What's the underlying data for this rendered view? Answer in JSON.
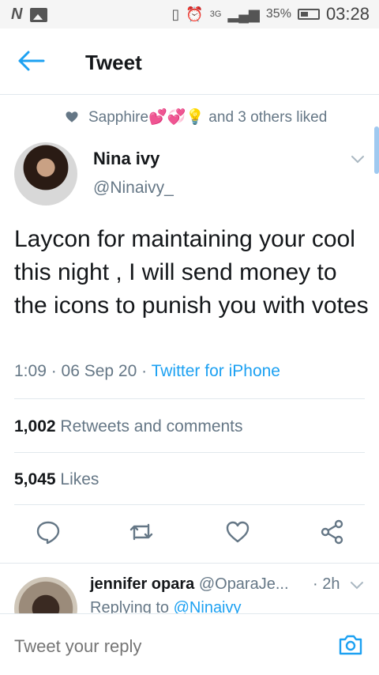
{
  "status_bar": {
    "left_icons": [
      "n-icon",
      "gallery-icon"
    ],
    "n_glyph": "N",
    "network": "3G",
    "battery": "35%",
    "time": "03:28"
  },
  "header": {
    "title": "Tweet"
  },
  "liked": {
    "text": "Sapphire💕💞💡 and 3 others liked"
  },
  "tweet": {
    "author_name": "Nina ivy",
    "author_handle": "@Ninaivy_",
    "text": "Laycon for maintaining your cool this night , I will send money to the icons to punish you with votes",
    "time": "1:09 · 06 Sep 20 · ",
    "source": "Twitter for iPhone",
    "retweets_count": "1,002",
    "retweets_label": "Retweets and comments",
    "likes_count": "5,045",
    "likes_label": "Likes"
  },
  "actions": [
    "comment-icon",
    "retweet-icon",
    "like-icon",
    "share-icon"
  ],
  "reply": {
    "name": "jennifer opara",
    "handle": "@OparaJe...",
    "time": "· 2h",
    "replying_prefix": "Replying to ",
    "replying_to": "@Ninaivy"
  },
  "composer": {
    "placeholder": "Tweet your reply"
  },
  "colors": {
    "accent": "#1da1f2",
    "secondary_text": "#657786",
    "divider": "#e1e8ed"
  }
}
